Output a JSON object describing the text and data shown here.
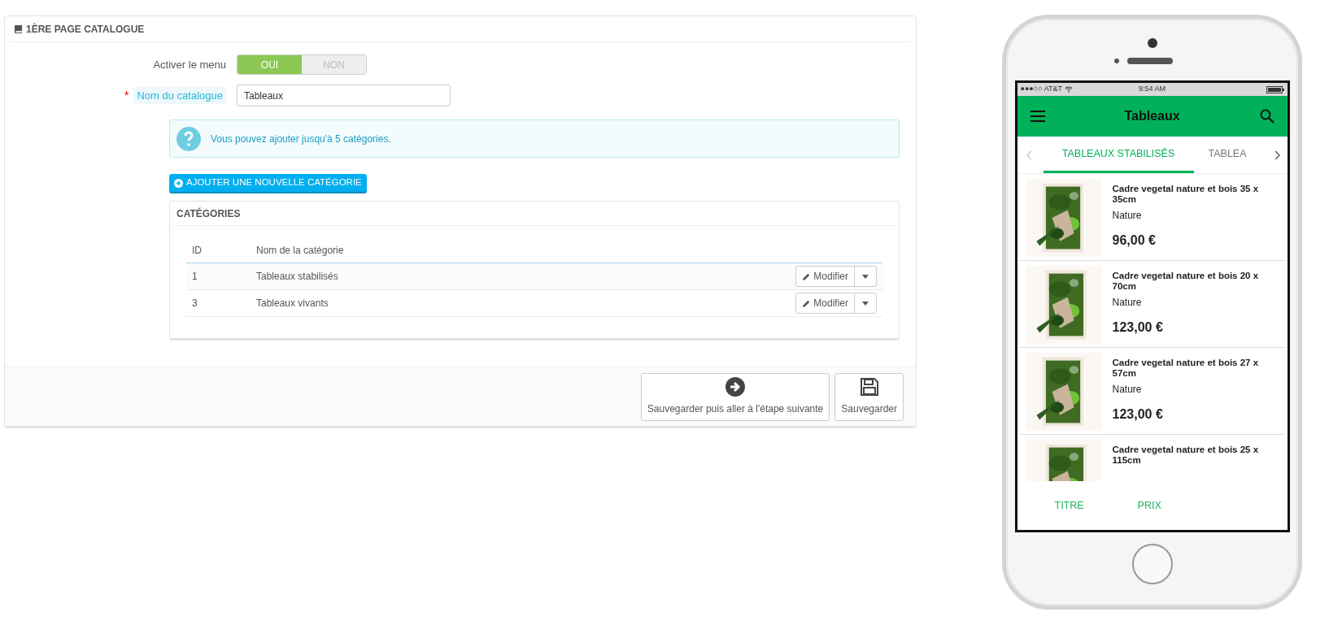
{
  "panel": {
    "title": "1ÈRE PAGE CATALOGUE",
    "menu_toggle": {
      "label": "Activer le menu",
      "options": [
        {
          "label": "OUI",
          "selected": true
        },
        {
          "label": "NON",
          "selected": false
        }
      ]
    },
    "catalog_name": {
      "required_mark": "*",
      "label": "Nom du catalogue",
      "value": "Tableaux"
    },
    "info": "Vous pouvez ajouter jusqu'à 5 catégories.",
    "add_button": "AJOUTER UNE NOUVELLE CATÉGORIE",
    "categories": {
      "title": "CATÉGORIES",
      "columns": [
        "ID",
        "Nom de la catégorie"
      ],
      "rows": [
        {
          "id": "1",
          "name": "Tableaux stabilisés",
          "action": "Modifier"
        },
        {
          "id": "3",
          "name": "Tableaux vivants",
          "action": "Modifier"
        }
      ]
    },
    "footer_buttons": [
      {
        "kind": "next",
        "label": "Sauvegarder puis aller à l'étape suivante"
      },
      {
        "kind": "save",
        "label": "Sauvegarder"
      }
    ]
  },
  "phone": {
    "status_bar": {
      "carrier": "●●●○○ AT&T",
      "time": "9:54 AM"
    },
    "title": "Tableaux",
    "tabs": [
      {
        "label": "TABLEAUX STABILISÉS",
        "selected": true
      },
      {
        "label": "TABLEA",
        "selected": false
      }
    ],
    "products": [
      {
        "name": "Cadre vegetal nature et bois 35 x 35cm",
        "brand": "Nature",
        "price": "96,00 €"
      },
      {
        "name": "Cadre vegetal nature et bois 20 x 70cm",
        "brand": "Nature",
        "price": "123,00 €"
      },
      {
        "name": "Cadre vegetal nature et bois 27 x 57cm",
        "brand": "Nature",
        "price": "123,00 €"
      },
      {
        "name": "Cadre vegetal nature et bois 25 x 115cm"
      }
    ],
    "sort_options": [
      "TITRE",
      "PRIX"
    ]
  }
}
